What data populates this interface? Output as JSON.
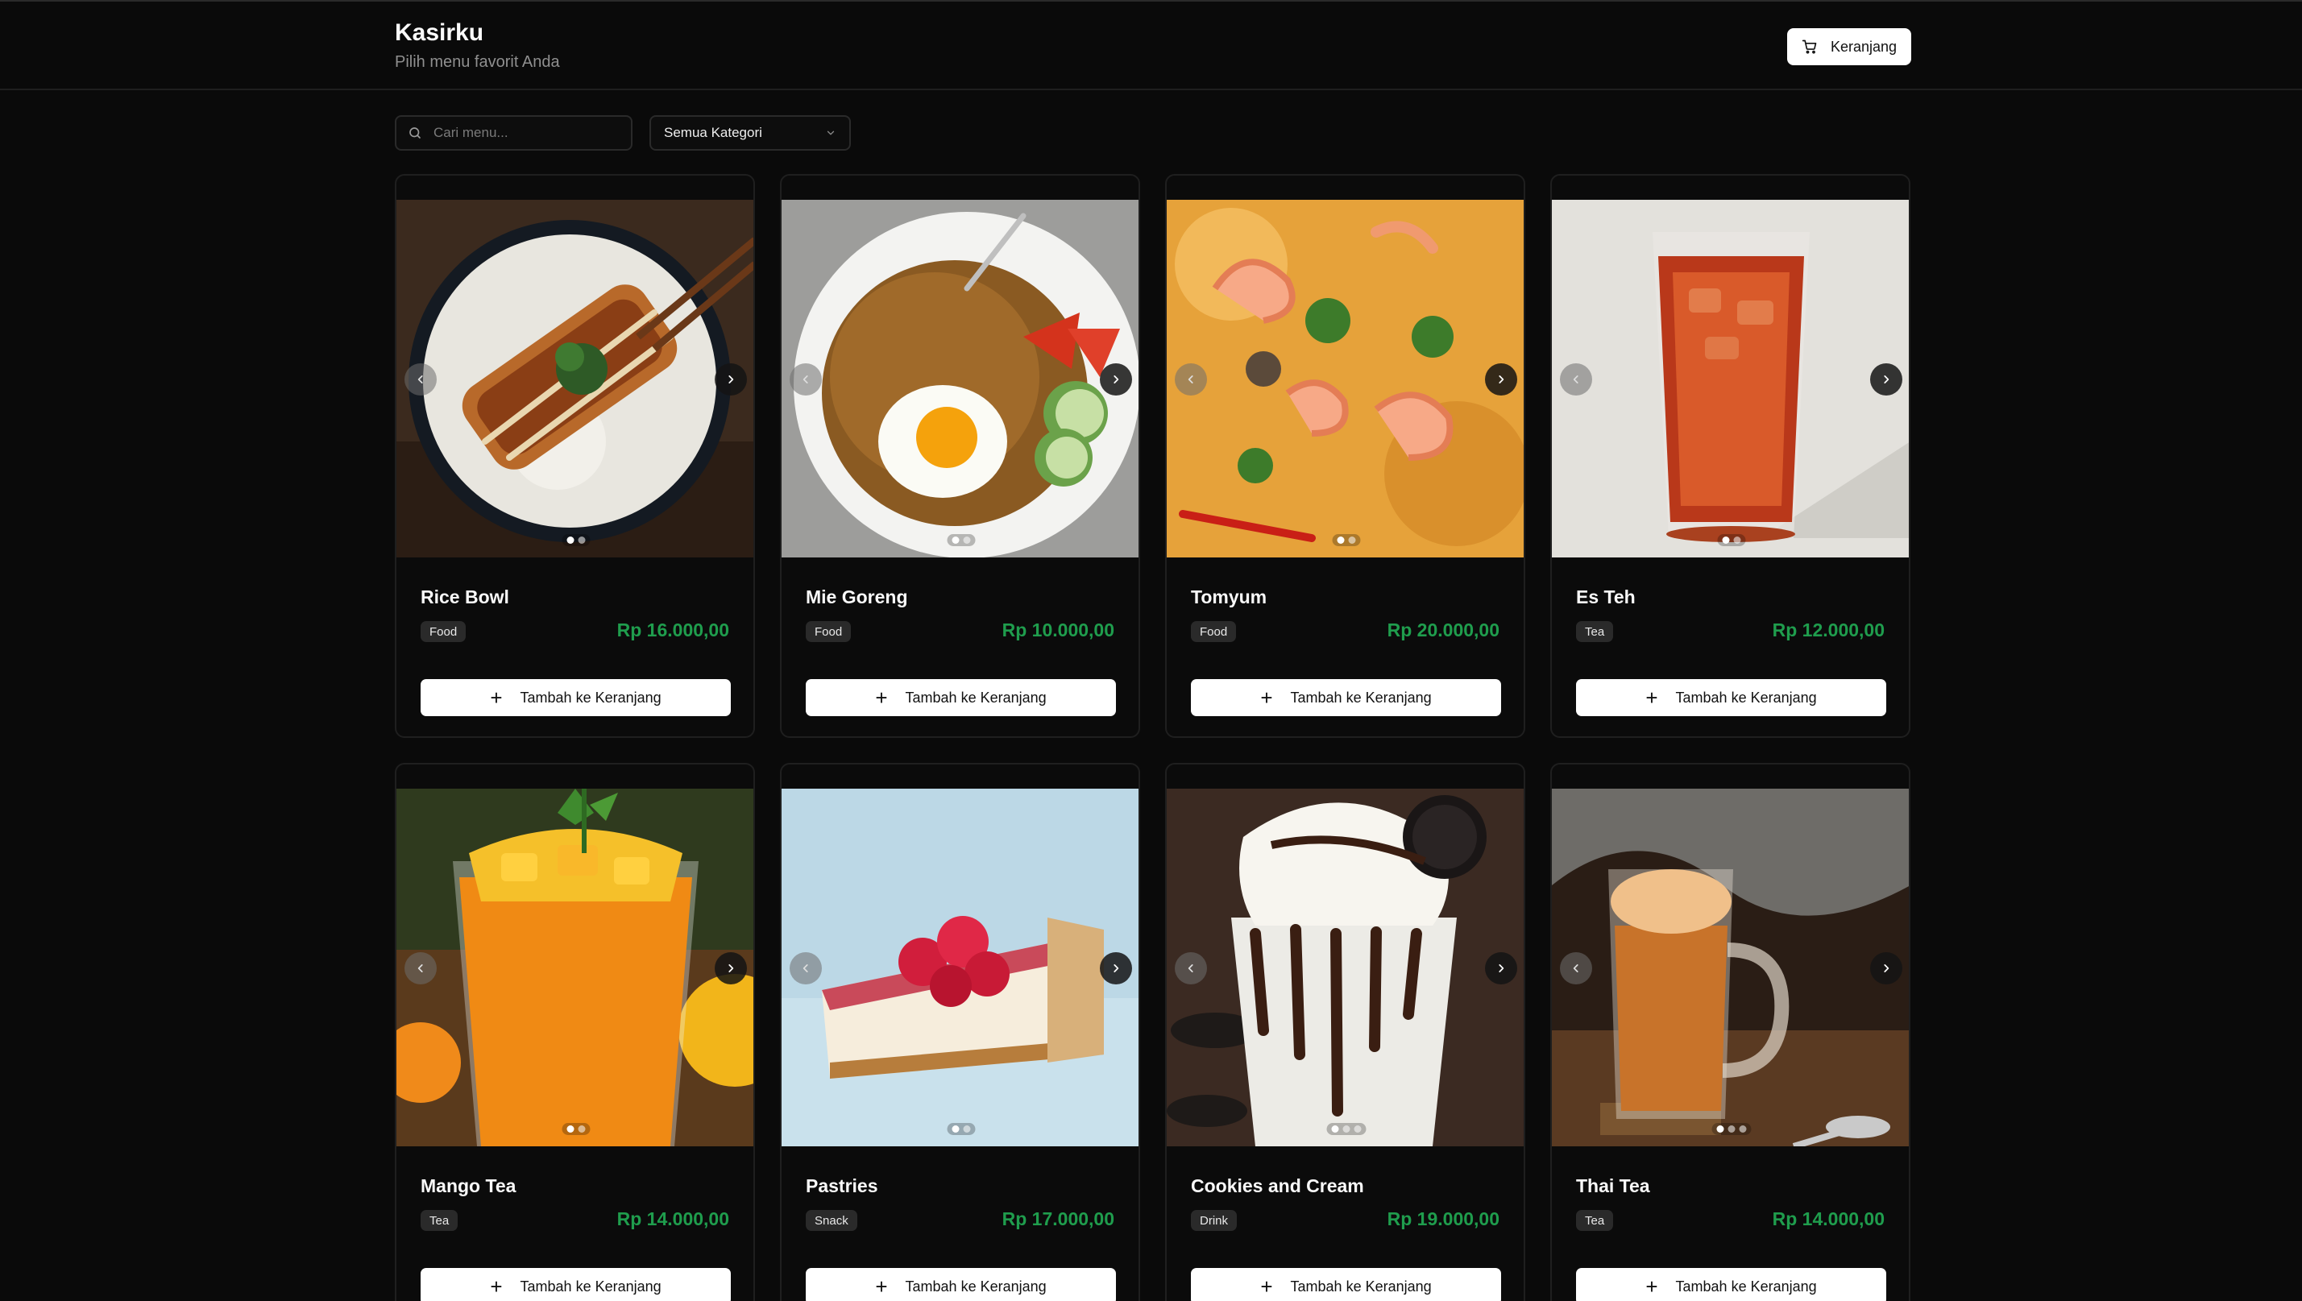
{
  "header": {
    "title": "Kasirku",
    "subtitle": "Pilih menu favorit Anda",
    "cart_label": "Keranjang"
  },
  "toolbar": {
    "search_placeholder": "Cari menu...",
    "category_selected": "Semua Kategori"
  },
  "colors": {
    "background": "#0a0a0a",
    "price": "#1f9d4d",
    "button": "#ffffff",
    "badge": "#2a2a2a"
  },
  "products": [
    {
      "name": "Rice Bowl",
      "category": "Food",
      "price": "Rp 16.000,00",
      "add_label": "Tambah ke Keranjang",
      "image_count": 2,
      "active_image": 0
    },
    {
      "name": "Mie Goreng",
      "category": "Food",
      "price": "Rp 10.000,00",
      "add_label": "Tambah ke Keranjang",
      "image_count": 2,
      "active_image": 0
    },
    {
      "name": "Tomyum",
      "category": "Food",
      "price": "Rp 20.000,00",
      "add_label": "Tambah ke Keranjang",
      "image_count": 2,
      "active_image": 0
    },
    {
      "name": "Es Teh",
      "category": "Tea",
      "price": "Rp 12.000,00",
      "add_label": "Tambah ke Keranjang",
      "image_count": 2,
      "active_image": 0
    },
    {
      "name": "Mango Tea",
      "category": "Tea",
      "price": "Rp 14.000,00",
      "add_label": "Tambah ke Keranjang",
      "image_count": 2,
      "active_image": 0
    },
    {
      "name": "Pastries",
      "category": "Snack",
      "price": "Rp 17.000,00",
      "add_label": "Tambah ke Keranjang",
      "image_count": 2,
      "active_image": 0
    },
    {
      "name": "Cookies and Cream",
      "category": "Drink",
      "price": "Rp 19.000,00",
      "add_label": "Tambah ke Keranjang",
      "image_count": 3,
      "active_image": 0
    },
    {
      "name": "Thai Tea",
      "category": "Tea",
      "price": "Rp 14.000,00",
      "add_label": "Tambah ke Keranjang",
      "image_count": 3,
      "active_image": 0
    }
  ]
}
